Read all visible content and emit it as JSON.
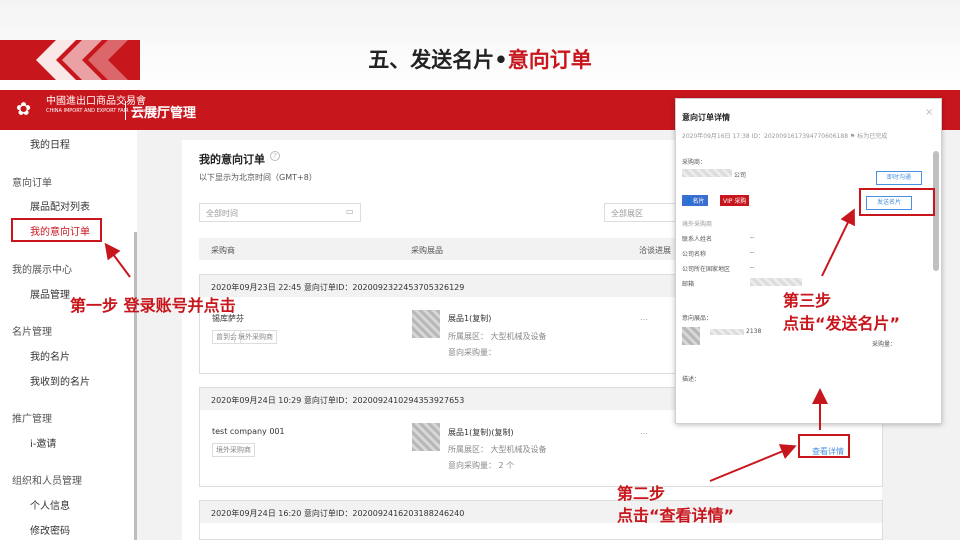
{
  "slide": {
    "title_prefix": "五、发送名片•",
    "title_accent": "意向订单"
  },
  "app": {
    "logo_text": "中國進出口商品交易會",
    "logo_sub": "CHINA IMPORT AND EXPORT FAIR · Since 1957",
    "title": "云展厅管理"
  },
  "sidebar": {
    "item_schedule": "我的日程",
    "group_orders": "意向订单",
    "item_product_match": "展品配对列表",
    "item_my_orders": "我的意向订单",
    "group_showcase": "我的展示中心",
    "item_product_manage": "展品管理",
    "group_cards": "名片管理",
    "item_my_card": "我的名片",
    "item_received_cards": "我收到的名片",
    "group_promo": "推广管理",
    "item_invite": "i-邀请",
    "group_org": "组织和人员管理",
    "item_personal": "个人信息",
    "item_password": "修改密码"
  },
  "page": {
    "title": "我的意向订单",
    "help_icon": "question-circle-icon",
    "subtitle": "以下显示为北京时间（GMT+8）",
    "filter_time_placeholder": "全部时间",
    "filter_zone_placeholder": "全部展区",
    "col_buyer": "采购商",
    "col_product": "采购展品",
    "col_status": "洽谈进展"
  },
  "orders": [
    {
      "header": "2020年09月23日 22:45   意向订单ID：20200923224537053261​29",
      "buyer": "锡库萨芬",
      "tags": [
        "曾到会",
        "境外采购商"
      ],
      "product": "展品1(复制)",
      "zone": "所属展区：  大型机械及设备",
      "qty": "意向采购量：",
      "status": "..."
    },
    {
      "header": "2020年09月24日 10:29   意向订单ID：20200924102943539276​53",
      "buyer": "test company 001",
      "tags": [
        "境外采购商"
      ],
      "product": "展品1(复制)(复制)",
      "zone": "所属展区：  大型机械及设备",
      "qty": "意向采购量：  2 个",
      "status": "..."
    },
    {
      "header": "2020年09月24日 16:20   意向订单ID：20200924162031882462​40",
      "buyer": "",
      "tags": [],
      "product": "",
      "zone": "",
      "qty": "",
      "status": ""
    }
  ],
  "view_detail_label": "查看详情",
  "modal": {
    "title": "意向订单详情",
    "close": "×",
    "meta": "2020年09月16日 17:38   ID：20200916173947​7060​6188   ⚑ 标为已完成",
    "buyer_label": "采购商：",
    "buyer_suffix": "公司",
    "badge_card": "名片",
    "badge_vip": "VIP 采购",
    "btn_chat": "即时沟通",
    "btn_send_card": "发送名片",
    "section_overseas": "境外采购商",
    "rows": [
      {
        "label": "联系人姓名",
        "value": "--"
      },
      {
        "label": "公司名称",
        "value": "--"
      },
      {
        "label": "公司所在国家地区",
        "value": "--"
      },
      {
        "label": "邮箱",
        "value": ""
      }
    ],
    "product_label": "意向展品：",
    "product_code": "2138",
    "product_qty": "采购量：",
    "desc_label": "描述："
  },
  "annotations": {
    "step1": "第一步   登录账号并点击",
    "step2_line1": "第二步",
    "step2_line2": "点击“查看详情”",
    "step3_line1": "第三步",
    "step3_line2": "点击“发送名片”"
  },
  "colors": {
    "brand_red": "#c8161d",
    "link_blue": "#4a90e2"
  }
}
